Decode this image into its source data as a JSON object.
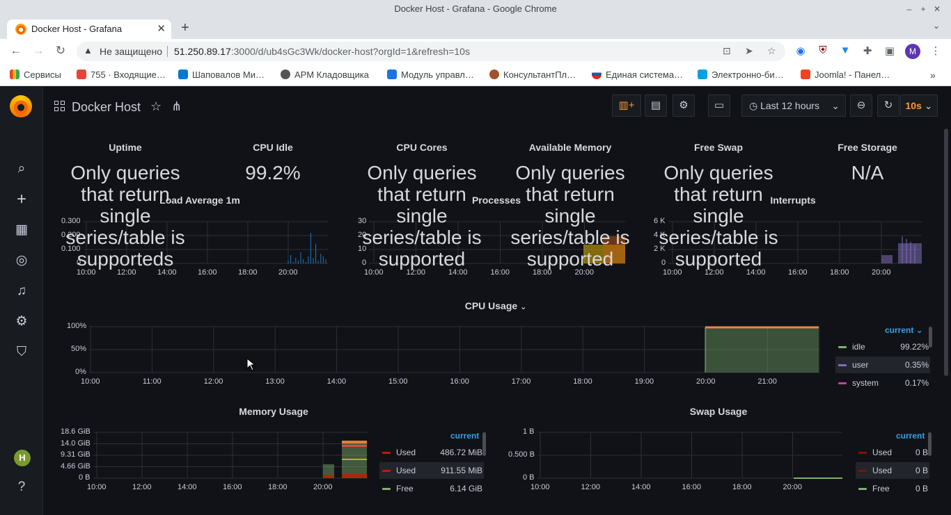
{
  "window": {
    "title": "Docker Host - Grafana - Google Chrome"
  },
  "tab": {
    "title": "Docker Host - Grafana",
    "close": "✕",
    "new": "+"
  },
  "address": {
    "security": "Не защищено",
    "host": "51.250.89.17",
    "path": ":3000/d/ub4sGc3Wk/docker-host?orgId=1&refresh=10s"
  },
  "profile": {
    "initial": "M"
  },
  "bookmarks": [
    {
      "label": "Сервисы",
      "color": "#4285f4"
    },
    {
      "label": "755 · Входящие…",
      "color": "#ea4335"
    },
    {
      "label": "Шаповалов Ми…",
      "color": "#0078d4"
    },
    {
      "label": "АРМ Кладовщика",
      "color": "#555555"
    },
    {
      "label": "Модуль управл…",
      "color": "#1a73e8"
    },
    {
      "label": "КонсультантПл…",
      "color": "#a0522d"
    },
    {
      "label": "Единая система…",
      "color": "#d52b1e"
    },
    {
      "label": "Электронно-би…",
      "color": "#00a0e3"
    },
    {
      "label": "Joomla! - Панел…",
      "color": "#f44321"
    }
  ],
  "dashboard": {
    "title": "Docker Host",
    "time_range": "Last 12 hours",
    "refresh": "10s",
    "user_initial": "H"
  },
  "stats": {
    "uptime": {
      "title": "Uptime",
      "text": "Only queries that return single series/table is supporteds"
    },
    "cpu_idle": {
      "title": "CPU Idle",
      "value": "99.2%"
    },
    "cpu_cores": {
      "title": "CPU Cores",
      "text": "Only queries that return single series/table is supported"
    },
    "available_memory": {
      "title": "Available Memory",
      "text": "Only queries that return single series/table is supported"
    },
    "free_swap": {
      "title": "Free Swap",
      "text": "Only queries that return single series/table is supported"
    },
    "free_storage": {
      "title": "Free Storage",
      "value": "N/A"
    }
  },
  "mini_graphs": {
    "load": {
      "title": "Load Average 1m",
      "yticks": [
        "0.300",
        "0.200",
        "0.100",
        "0"
      ],
      "xticks": [
        "10:00",
        "12:00",
        "14:00",
        "16:00",
        "18:00",
        "20:00"
      ]
    },
    "processes": {
      "title": "Processes",
      "yticks": [
        "30",
        "20",
        "10",
        "0"
      ],
      "xticks": [
        "10:00",
        "12:00",
        "14:00",
        "16:00",
        "18:00",
        "20:00"
      ]
    },
    "interrupts": {
      "title": "Interrupts",
      "yticks": [
        "6 K",
        "4 K",
        "2 K",
        "0"
      ],
      "xticks": [
        "10:00",
        "12:00",
        "14:00",
        "16:00",
        "18:00",
        "20:00"
      ]
    }
  },
  "cpu_usage": {
    "title": "CPU Usage",
    "caret": "⌄",
    "yticks": [
      "100%",
      "50%",
      "0%"
    ],
    "xticks": [
      "10:00",
      "11:00",
      "12:00",
      "13:00",
      "14:00",
      "15:00",
      "16:00",
      "17:00",
      "18:00",
      "19:00",
      "20:00",
      "21:00"
    ],
    "legend_head": "current ⌄",
    "legend": [
      {
        "name": "idle",
        "value": "99.22%",
        "color": "#7eb26d"
      },
      {
        "name": "user",
        "value": "0.35%",
        "color": "#806eb7"
      },
      {
        "name": "system",
        "value": "0.17%",
        "color": "#ba43a9"
      }
    ]
  },
  "memory_usage": {
    "title": "Memory Usage",
    "yticks": [
      "18.6 GiB",
      "14.0 GiB",
      "9.31 GiB",
      "4.66 GiB",
      "0 B"
    ],
    "xticks": [
      "10:00",
      "12:00",
      "14:00",
      "16:00",
      "18:00",
      "20:00"
    ],
    "legend_head": "current",
    "legend": [
      {
        "name": "Used",
        "value": "486.72 MiB",
        "color": "#bf1b00"
      },
      {
        "name": "Used",
        "value": "911.55 MiB",
        "color": "#bf1b00"
      },
      {
        "name": "Free",
        "value": "6.14 GiB",
        "color": "#7eb26d"
      }
    ]
  },
  "swap_usage": {
    "title": "Swap Usage",
    "yticks": [
      "1 B",
      "0.500 B",
      "0 B"
    ],
    "xticks": [
      "10:00",
      "12:00",
      "14:00",
      "16:00",
      "18:00",
      "20:00"
    ],
    "legend_head": "current",
    "legend": [
      {
        "name": "Used",
        "value": "0 B",
        "color": "#890f02"
      },
      {
        "name": "Used",
        "value": "0 B",
        "color": "#890f02"
      },
      {
        "name": "Free",
        "value": "0 B",
        "color": "#7eb26d"
      }
    ]
  },
  "chart_data": [
    {
      "type": "line",
      "title": "Load Average 1m",
      "ylim": [
        0,
        0.3
      ],
      "x": [
        "10:00",
        "12:00",
        "14:00",
        "16:00",
        "18:00",
        "20:00"
      ],
      "note_series": "spikes near 20:00–21:00 up to ~0.22"
    },
    {
      "type": "area",
      "title": "CPU Usage",
      "ylim": [
        0,
        100
      ],
      "series": [
        {
          "name": "idle",
          "values": [
            99.22
          ]
        },
        {
          "name": "user",
          "values": [
            0.35
          ]
        },
        {
          "name": "system",
          "values": [
            0.17
          ]
        }
      ]
    }
  ]
}
